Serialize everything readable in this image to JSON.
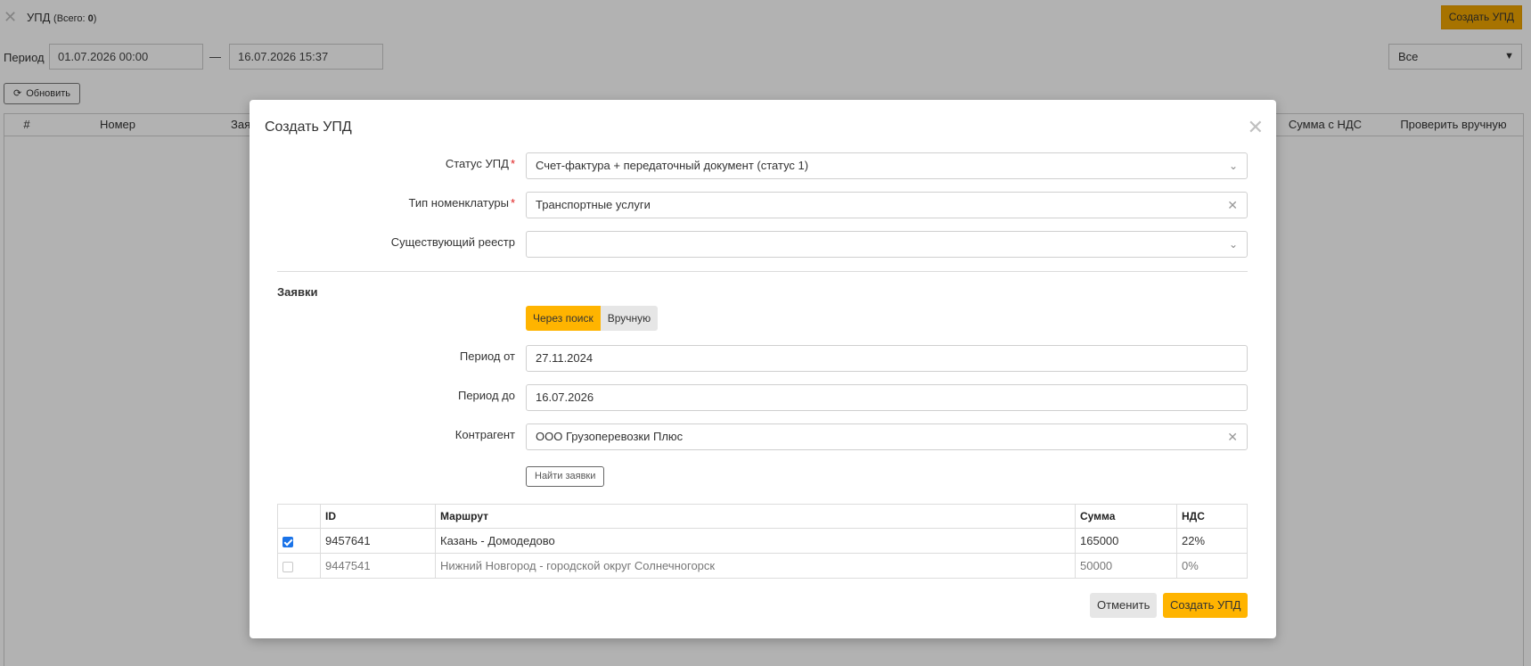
{
  "background": {
    "title": "УПД",
    "total_prefix": "(Всего: ",
    "total_count": "0",
    "total_suffix": ")",
    "create_button": "Создать УПД",
    "period_label": "Период",
    "period_from": "01.07.2026 00:00",
    "period_dash": "—",
    "period_to": "16.07.2026 15:37",
    "filter_select": "Все",
    "refresh_button": "Обновить",
    "table_headers": {
      "num": "#",
      "number": "Номер",
      "requests": "Зая",
      "sum_vat": "Сумма с НДС",
      "check_manual": "Проверить вручную"
    }
  },
  "modal": {
    "title": "Создать УПД",
    "status_label": "Статус УПД",
    "status_value": "Счет-фактура + передаточный документ (статус 1)",
    "nomenclature_label": "Тип номенклатуры",
    "nomenclature_value": "Транспортные услуги",
    "registry_label": "Существующий реестр",
    "registry_value": "",
    "section_title": "Заявки",
    "toggle": {
      "search": "Через поиск",
      "manual": "Вручную"
    },
    "period_from_label": "Период от",
    "period_from_value": "27.11.2024",
    "period_to_label": "Период до",
    "period_to_value": "16.07.2026",
    "counterparty_label": "Контрагент",
    "counterparty_value": "ООО Грузоперевозки Плюс",
    "find_button": "Найти заявки",
    "table": {
      "headers": {
        "id": "ID",
        "route": "Маршрут",
        "sum": "Сумма",
        "vat": "НДС"
      },
      "rows": [
        {
          "checked": true,
          "id": "9457641",
          "route": "Казань - Домодедово",
          "sum": "165000",
          "vat": "22%"
        },
        {
          "checked": false,
          "id": "9447541",
          "route": "Нижний Новгород - городской округ Солнечногорск",
          "sum": "50000",
          "vat": "0%"
        }
      ]
    },
    "cancel_button": "Отменить",
    "submit_button": "Создать УПД"
  },
  "icons": {
    "close": "close-icon",
    "refresh": "refresh-icon",
    "chevron": "chevron-down-icon",
    "clear": "clear-icon"
  },
  "colors": {
    "accent": "#ffb400",
    "checkbox": "#1a73e8",
    "required": "#e02020"
  }
}
